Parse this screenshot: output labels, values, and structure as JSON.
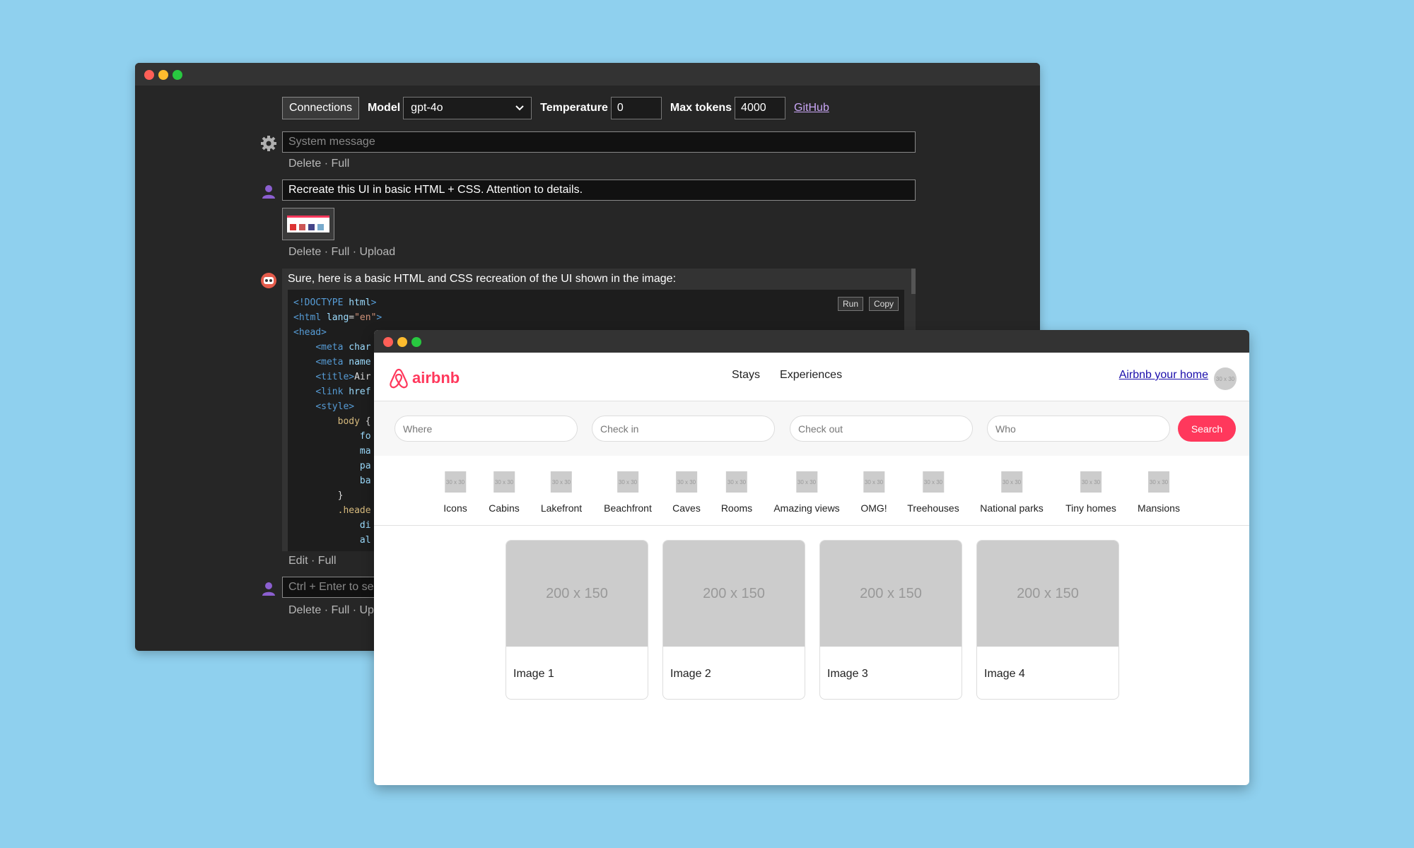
{
  "back_window": {
    "toolbar": {
      "connections_label": "Connections",
      "model_label": "Model",
      "model_value": "gpt-4o",
      "temperature_label": "Temperature",
      "temperature_value": "0",
      "max_tokens_label": "Max tokens",
      "max_tokens_value": "4000",
      "github_label": "GitHub"
    },
    "system_message": {
      "placeholder": "System message",
      "links": "Delete · Full"
    },
    "user_message": {
      "text": "Recreate this UI in basic HTML + CSS. Attention to details.",
      "links": "Delete · Full · Upload"
    },
    "assistant_message": {
      "text": "Sure, here is a basic HTML and CSS recreation of the UI shown in the image:",
      "run_label": "Run",
      "copy_label": "Copy",
      "links": "Edit · Full"
    },
    "new_message": {
      "placeholder": "Ctrl + Enter to se",
      "links": "Delete · Full · Uplo"
    }
  },
  "airbnb_window": {
    "logo_text": "airbnb",
    "nav": [
      "Stays",
      "Experiences"
    ],
    "host_link": "Airbnb your home",
    "avatar_text": "30 x 30",
    "search": {
      "where": "Where",
      "check_in": "Check in",
      "check_out": "Check out",
      "who": "Who",
      "button": "Search"
    },
    "category_img_text": "30 x 30",
    "categories": [
      "Icons",
      "Cabins",
      "Lakefront",
      "Beachfront",
      "Caves",
      "Rooms",
      "Amazing views",
      "OMG!",
      "Treehouses",
      "National parks",
      "Tiny homes",
      "Mansions"
    ],
    "cards": [
      {
        "image_text": "200 x 150",
        "title": "Image 1"
      },
      {
        "image_text": "200 x 150",
        "title": "Image 2"
      },
      {
        "image_text": "200 x 150",
        "title": "Image 3"
      },
      {
        "image_text": "200 x 150",
        "title": "Image 4"
      }
    ]
  },
  "colors": {
    "background": "#8fd0ee",
    "airbnb_brand": "#ff385c",
    "dark_window": "#262626"
  }
}
